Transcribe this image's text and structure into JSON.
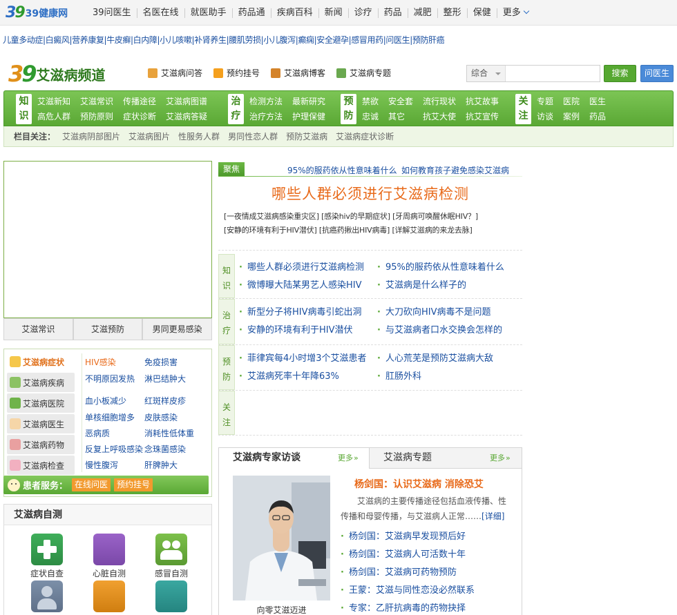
{
  "top": {
    "logo_num": "39",
    "logo_text": "39健康网",
    "nav": [
      "39问医生",
      "名医在线",
      "就医助手",
      "药品通",
      "疾病百科",
      "新闻",
      "诊疗",
      "药品",
      "减肥",
      "整形",
      "保健"
    ],
    "more": "更多"
  },
  "tags": [
    "儿童多动症",
    "白癜风",
    "营养康复",
    "牛皮癣",
    "白内障",
    "小儿咳嗽",
    "补肾养生",
    "腰肌劳损",
    "小儿腹泻",
    "癫痫",
    "安全避孕",
    "感冒用药",
    "问医生",
    "预防肝癌"
  ],
  "channel": {
    "logo_num": "39",
    "logo_text": "39艾滋病频道",
    "links": [
      "艾滋病问答",
      "预约挂号",
      "艾滋病博客",
      "艾滋病专题"
    ],
    "search_select": "综合",
    "search_placeholder": "",
    "search_button": "搜索",
    "ask_button": "问医生"
  },
  "gnav": [
    {
      "tag": "知识",
      "items": [
        "艾滋新知",
        "高危人群",
        "艾滋常识",
        "预防原则",
        "传播途径",
        "症状诊断",
        "艾滋病图谱",
        "艾滋病答疑"
      ]
    },
    {
      "tag": "治疗",
      "items": [
        "检测方法",
        "治疗方法",
        "最新研究",
        "护理保健"
      ]
    },
    {
      "tag": "预防",
      "items": [
        "禁欲",
        "忠诚",
        "安全套",
        "其它",
        "流行现状",
        "抗艾大使",
        "抗艾故事",
        "抗艾宣传"
      ]
    },
    {
      "tag": "关注",
      "items": [
        "专题",
        "访谈",
        "医院",
        "案例",
        "医生",
        "药品"
      ]
    }
  ],
  "subbar": {
    "label": "栏目关注：",
    "items": [
      "艾滋病阴部图片",
      "艾滋病图片",
      "性服务人群",
      "男同性恋人群",
      "预防艾滋病",
      "艾滋病症状诊断"
    ]
  },
  "slide_tabs": [
    "艾滋常识",
    "艾滋预防",
    "男同更易感染"
  ],
  "categories": {
    "side": [
      "艾滋病症状",
      "艾滋病疾病",
      "艾滋病医院",
      "艾滋病医生",
      "艾滋病药物",
      "艾滋病检查"
    ],
    "items": [
      "HIV感染",
      "免疫损害",
      "不明原因发热",
      "淋巴结肿大",
      "血小板减少",
      "红斑样皮疹",
      "单核细胞增多",
      "皮肤感染",
      "恶病质",
      "消耗性低体重",
      "反复上呼吸感染",
      "念珠菌感染",
      "慢性腹泻",
      "肝脾肿大"
    ]
  },
  "patient": {
    "label": "患者服务：",
    "buttons": [
      "在线问医",
      "预约挂号"
    ]
  },
  "selftest": {
    "title": "艾滋病自测",
    "tools": [
      "症状自查",
      "心脏自测",
      "感冒自测",
      "",
      "",
      ""
    ]
  },
  "focus": {
    "badge": "聚焦",
    "top_links": [
      "95%的服药依从性意味着什么",
      "如何教育孩子避免感染艾滋病"
    ],
    "headline": "哪些人群必须进行艾滋病检测",
    "related1": "[一夜情成艾滋病感染重灾区] [感染hiv的早期症状] [牙周病可唤醒休眠HIV？]",
    "related2": "[安静的环境有利于HIV潜伏] [抗癌药揪出HIV病毒] [详解艾滋病的来龙去脉]"
  },
  "kblocks": [
    {
      "label": "知识",
      "items": [
        "哪些人群必须进行艾滋病检测",
        "95%的服药依从性意味着什么",
        "微博曝大陆某男艺人感染HIV",
        "艾滋病是什么样子的"
      ]
    },
    {
      "label": "治疗",
      "items": [
        "新型分子将HIV病毒引蛇出洞",
        "大刀砍向HIV病毒不是问题",
        "安静的环境有利于HIV潜伏",
        "与艾滋病者口水交换会怎样的"
      ]
    },
    {
      "label": "预防",
      "items": [
        "菲律宾每4小时增3个艾滋患者",
        "人心荒芜是预防艾滋病大敌",
        "艾滋病死率十年降63%",
        "肛肠外科"
      ]
    },
    {
      "label": "关注",
      "items": []
    }
  ],
  "expert": {
    "tab1": "艾滋病专家访谈",
    "tab2": "艾滋病专题",
    "more": "更多",
    "caption": "向零艾滋迈进",
    "title": "杨剑国：认识艾滋病 消除恐艾",
    "desc": "艾滋病的主要传播途径包括血液传播、性传播和母婴传播，与艾滋病人正常……",
    "detail": "[详细]",
    "links": [
      "杨剑国：艾滋病早发现预后好",
      "杨剑国：艾滋病人可活数十年",
      "杨剑国：艾滋病可药物预防",
      "王蒙：艾滋与同性恋没必然联系",
      "专家：乙肝抗病毒的药物抉择"
    ]
  },
  "colors": {
    "accent": "#5aa834",
    "link": "#1a4fa0",
    "highlight": "#e86a1a"
  }
}
